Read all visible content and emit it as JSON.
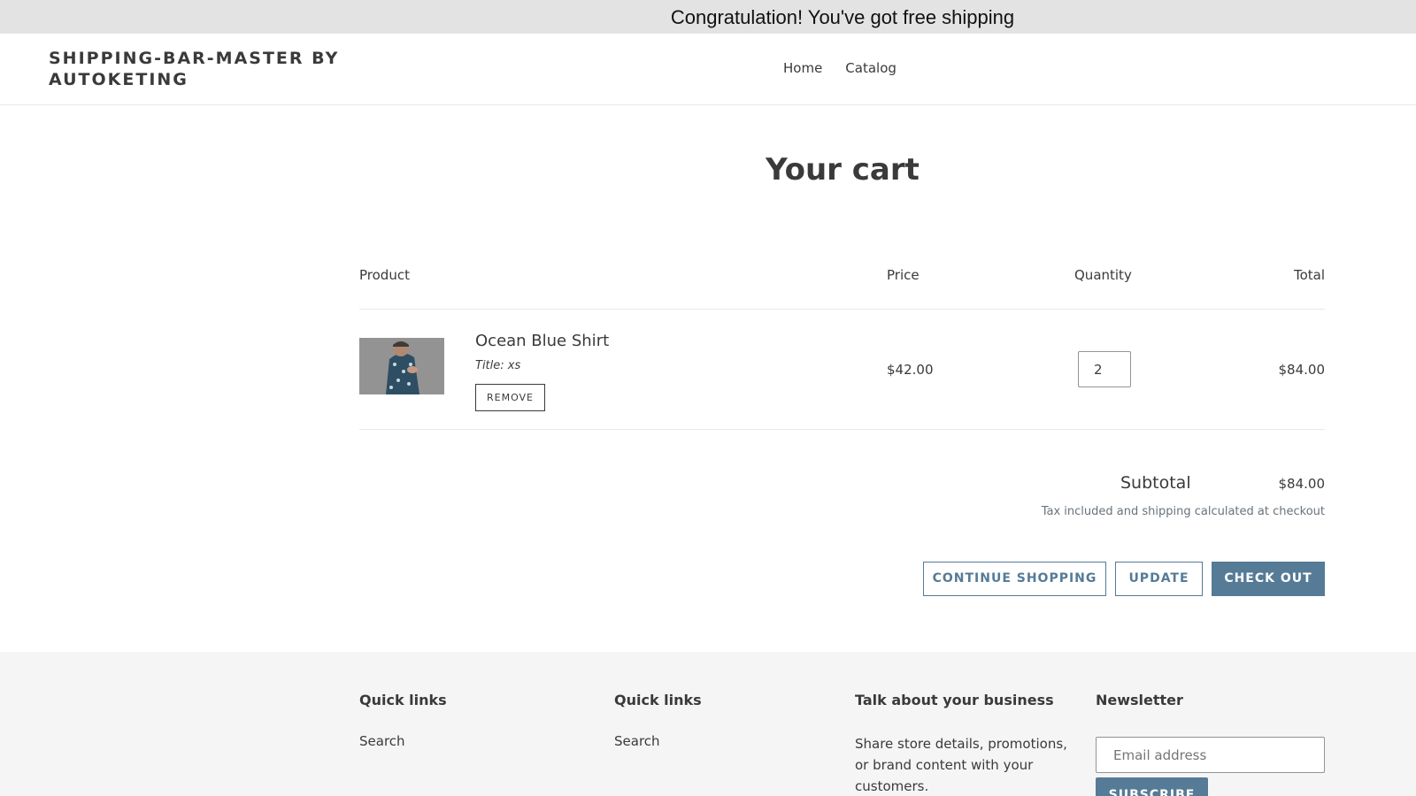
{
  "announcement": {
    "text": "Congratulation! You've got free shipping"
  },
  "header": {
    "logo": "SHIPPING-BAR-MASTER BY AUTOKETING",
    "nav": [
      "Home",
      "Catalog"
    ]
  },
  "cart": {
    "title": "Your cart",
    "columns": {
      "product": "Product",
      "price": "Price",
      "quantity": "Quantity",
      "total": "Total"
    },
    "items": [
      {
        "name": "Ocean Blue Shirt",
        "variant": "Title: xs",
        "remove_label": "REMOVE",
        "price": "$42.00",
        "quantity": "2",
        "total": "$84.00"
      }
    ],
    "subtotal_label": "Subtotal",
    "subtotal_value": "$84.00",
    "tax_note": "Tax included and shipping calculated at checkout",
    "buttons": {
      "continue": "CONTINUE SHOPPING",
      "update": "UPDATE",
      "checkout": "CHECK OUT"
    }
  },
  "footer": {
    "col1": {
      "heading": "Quick links",
      "link": "Search"
    },
    "col2": {
      "heading": "Quick links",
      "link": "Search"
    },
    "col3": {
      "heading": "Talk about your business",
      "text": "Share store details, promotions, or brand content with your customers."
    },
    "newsletter": {
      "heading": "Newsletter",
      "placeholder": "Email address",
      "button": "SUBSCRIBE"
    }
  },
  "colors": {
    "accent": "#557b97",
    "announcement_bg": "#e3e3e3",
    "footer_bg": "#f5f5f5"
  }
}
